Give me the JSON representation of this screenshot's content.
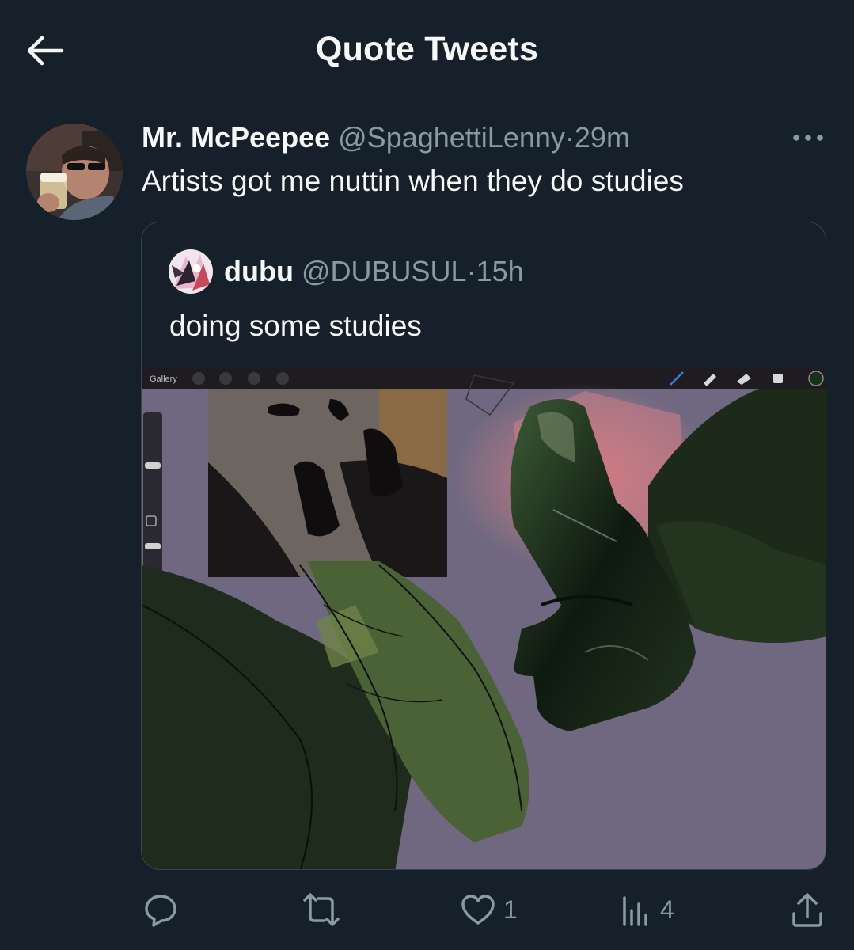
{
  "header": {
    "title": "Quote Tweets",
    "back_icon": "arrow-left-icon"
  },
  "tweet": {
    "display_name": "Mr. McPeepee",
    "handle": "@SpaghettiLenny",
    "separator": "·",
    "time": "29m",
    "text": "Artists got me nuttin when they do studies",
    "more_icon": "more-horizontal-icon"
  },
  "quoted": {
    "display_name": "dubu",
    "handle": "@DUBUSUL",
    "separator": "·",
    "time": "15h",
    "text": "doing some studies",
    "media": {
      "toolbar_gallery": "Gallery"
    }
  },
  "actions": {
    "reply_icon": "reply-icon",
    "retweet_icon": "retweet-icon",
    "like_icon": "heart-icon",
    "like_count": "1",
    "views_icon": "views-chart-icon",
    "views_count": "4",
    "share_icon": "share-icon"
  },
  "colors": {
    "background": "#15202b",
    "text": "#f7f9f9",
    "muted": "#8b98a5",
    "border": "#38444d",
    "canvas": "#6f6880"
  }
}
